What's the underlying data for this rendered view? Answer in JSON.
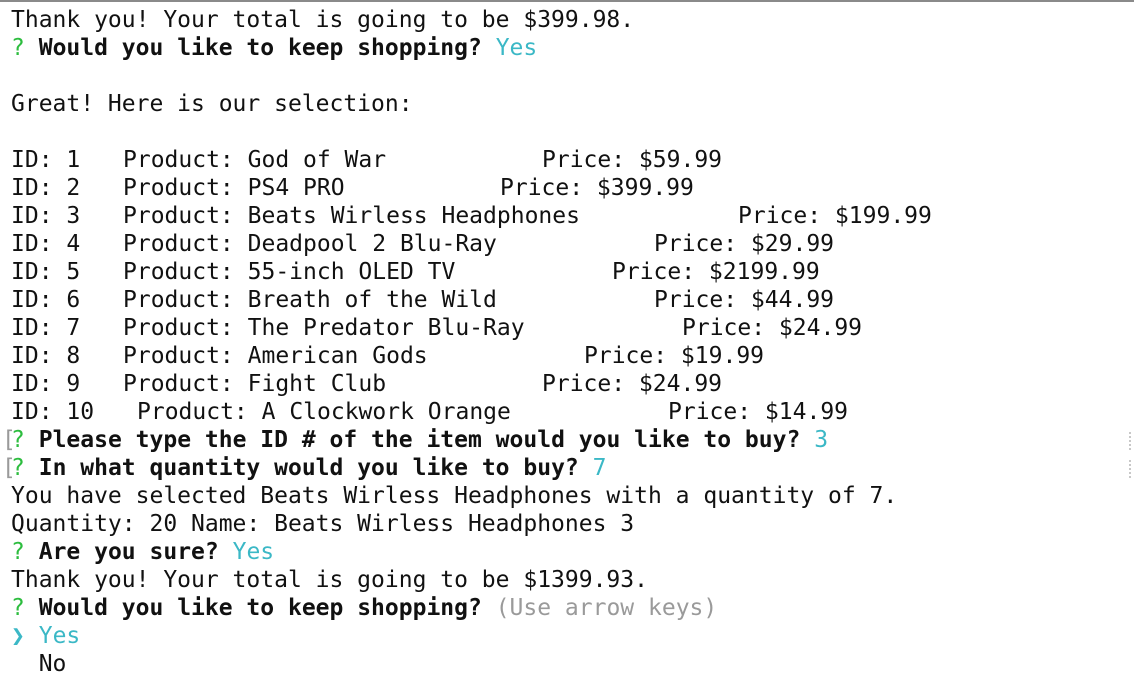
{
  "terminal": {
    "line_total_1": "Thank you! Your total is going to be $399.98.",
    "prompt_symbol": "?",
    "keep_shopping_q": "Would you like to keep shopping?",
    "keep_shopping_a1": "Yes",
    "great_line": "Great! Here is our selection:",
    "products": [
      {
        "id": "ID: 1",
        "product": "Product: God of War",
        "price": "Price: $59.99"
      },
      {
        "id": "ID: 2",
        "product": "Product: PS4 PRO",
        "price": "Price: $399.99"
      },
      {
        "id": "ID: 3",
        "product": "Product: Beats Wirless Headphones",
        "price": "Price: $199.99"
      },
      {
        "id": "ID: 4",
        "product": "Product: Deadpool 2 Blu-Ray",
        "price": "Price: $29.99"
      },
      {
        "id": "ID: 5",
        "product": "Product: 55-inch OLED TV",
        "price": "Price: $2199.99"
      },
      {
        "id": "ID: 6",
        "product": "Product: Breath of the Wild",
        "price": "Price: $44.99"
      },
      {
        "id": "ID: 7",
        "product": "Product: The Predator Blu-Ray",
        "price": "Price: $24.99"
      },
      {
        "id": "ID: 8",
        "product": "Product: American Gods",
        "price": "Price: $19.99"
      },
      {
        "id": "ID: 9",
        "product": "Product: Fight Club",
        "price": "Price: $24.99"
      },
      {
        "id": "ID: 10",
        "product": "Product: A Clockwork Orange",
        "price": "Price: $14.99"
      }
    ],
    "bracket": "[",
    "id_q": "Please type the ID # of the item would you like to buy?",
    "id_a": "3",
    "qty_q": "In what quantity would you like to buy?",
    "qty_a": "7",
    "selected_line": "You have selected Beats Wirless Headphones with a quantity of 7.",
    "qty_name_line": "Quantity: 20 Name: Beats Wirless Headphones 3",
    "sure_q": "Are you sure?",
    "sure_a": "Yes",
    "line_total_2": "Thank you! Your total is going to be $1399.93.",
    "keep_shopping_hint": "(Use arrow keys)",
    "pointer": "❯",
    "option_yes": "Yes",
    "option_no": "No"
  },
  "colors": {
    "prompt_green": "#2dbd3f",
    "answer_cyan": "#3bb8c6",
    "hint_gray": "#9a9a9a"
  }
}
